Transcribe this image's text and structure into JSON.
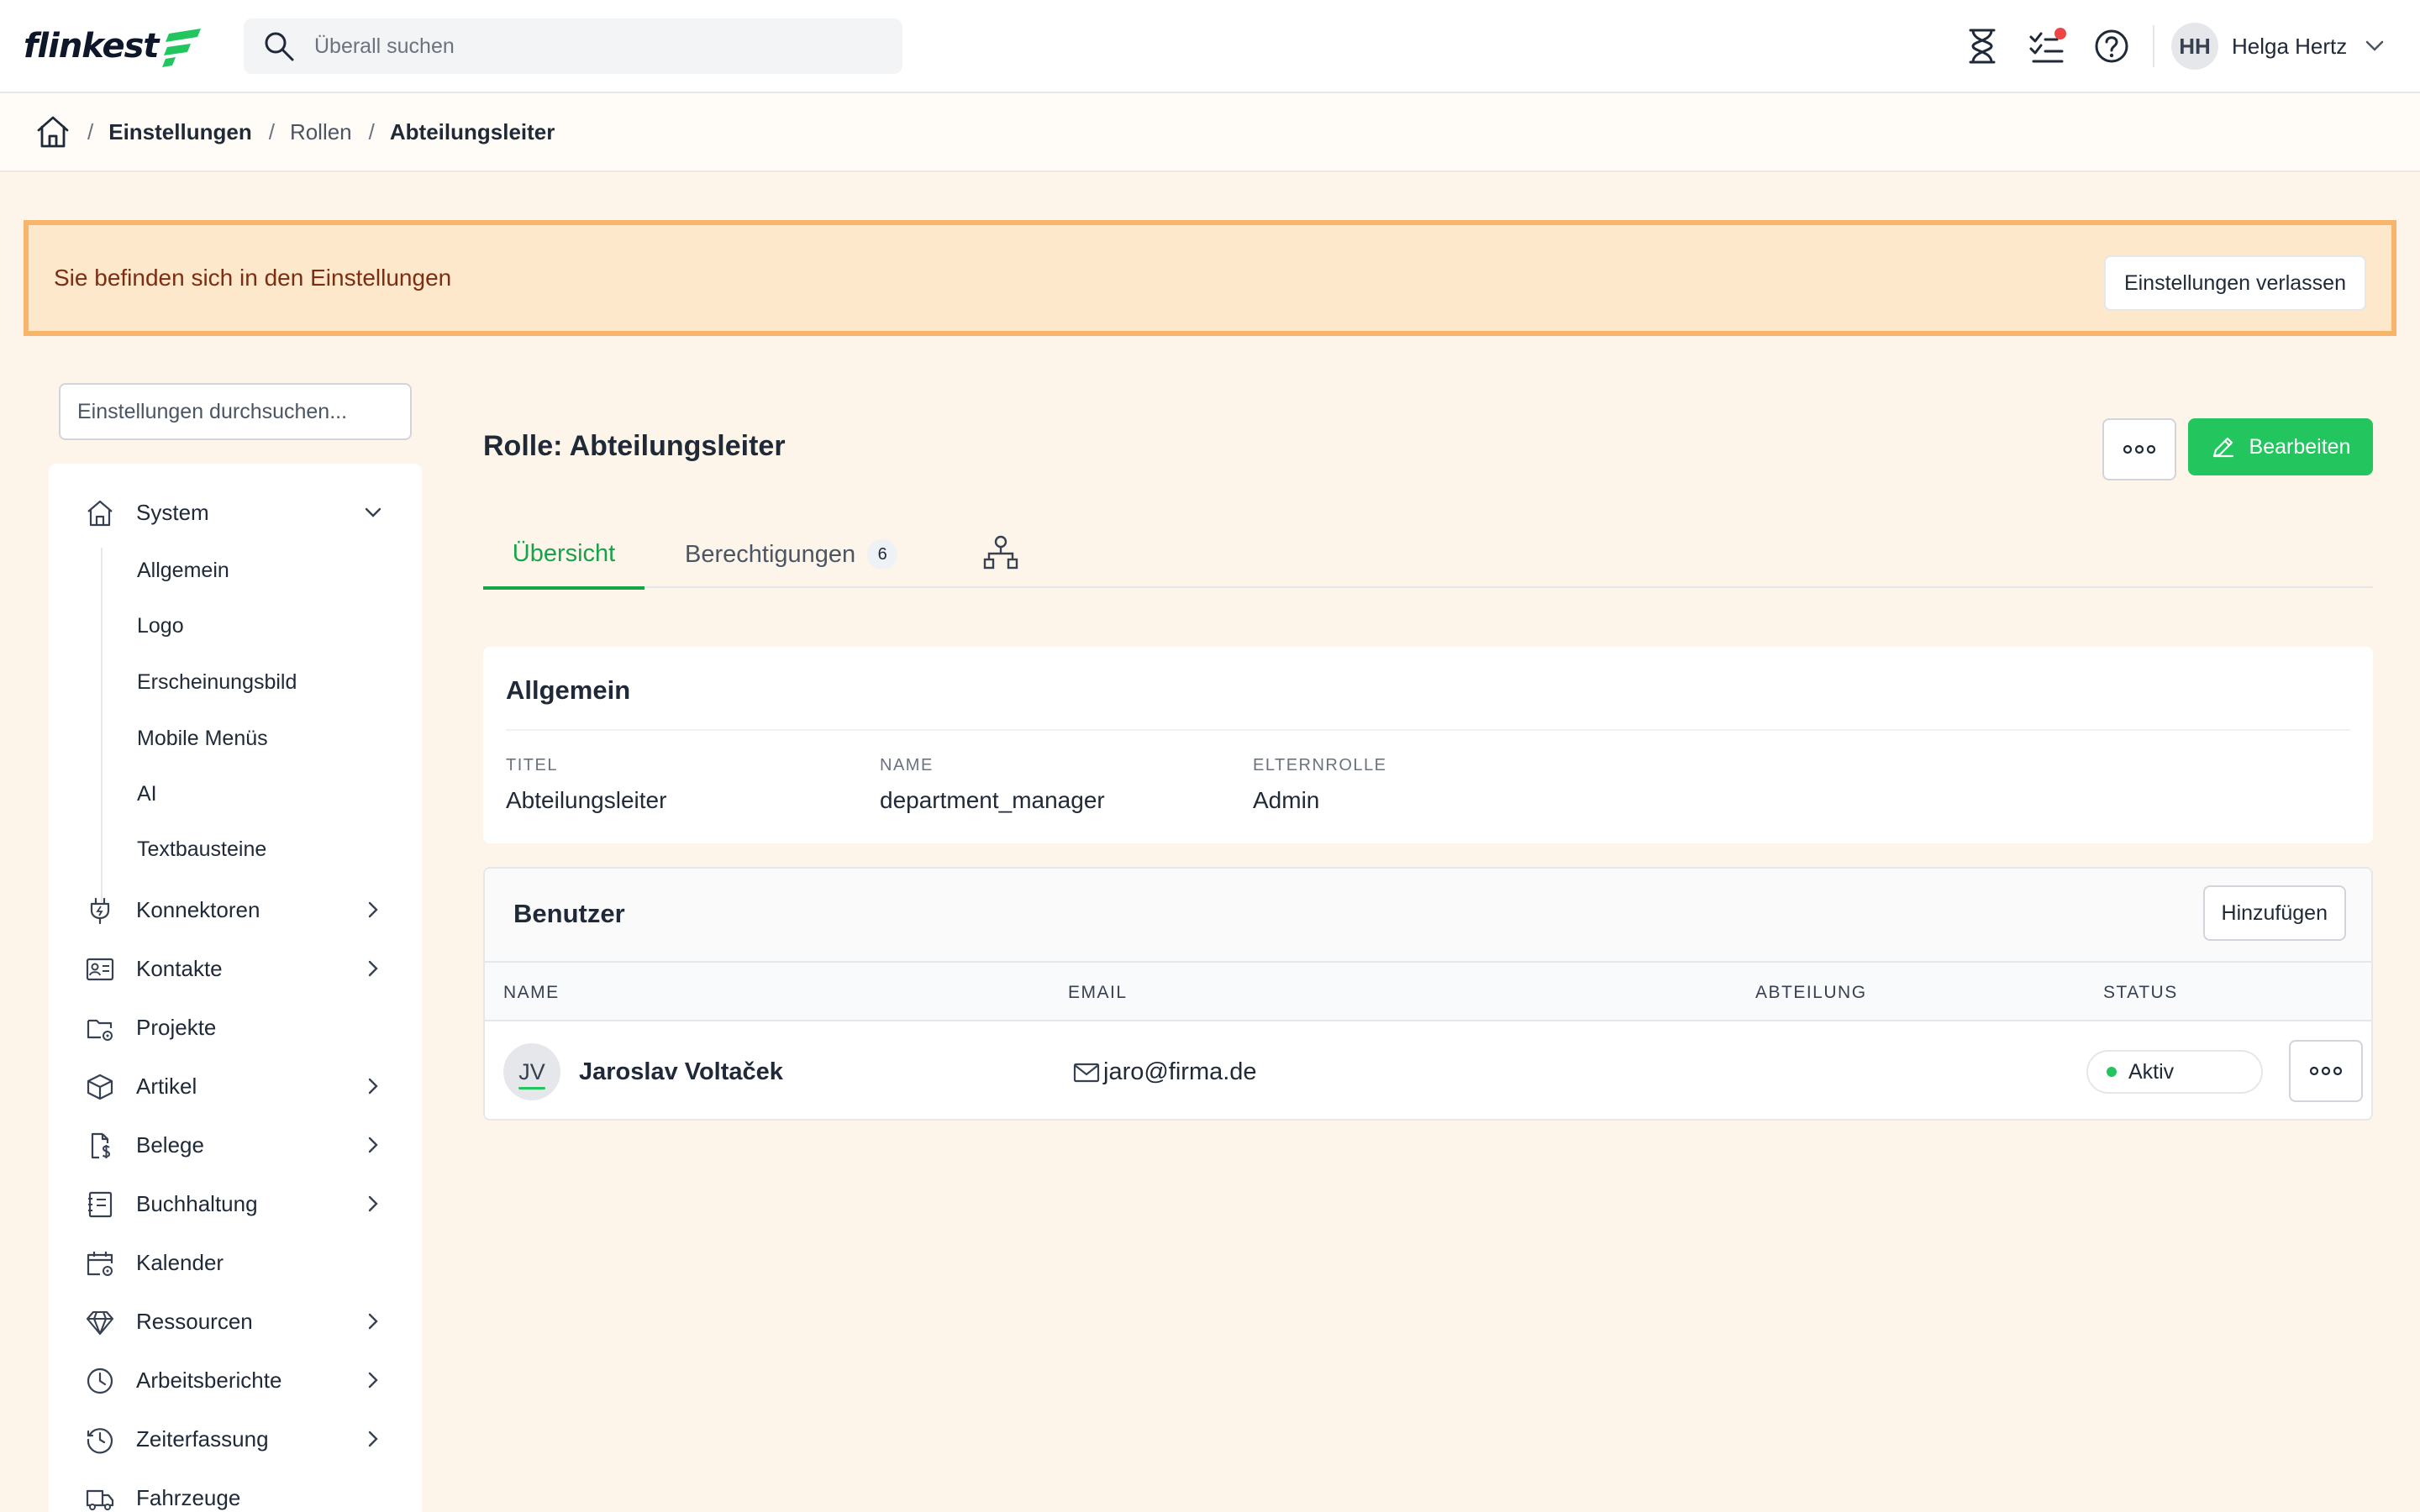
{
  "app": {
    "logo_text": "flinkest"
  },
  "topbar": {
    "search_placeholder": "Überall suchen",
    "user": {
      "initials": "HH",
      "name": "Helga Hertz"
    },
    "icons": [
      "hourglass-icon",
      "tasks-icon",
      "help-icon",
      "chevron-down-icon"
    ],
    "notification_color": "#ef4444"
  },
  "breadcrumb": {
    "items": [
      "Einstellungen",
      "Rollen",
      "Abteilungsleiter"
    ]
  },
  "banner": {
    "text": "Sie befinden sich in den Einstellungen",
    "button": "Einstellungen verlassen"
  },
  "sidebar": {
    "search_placeholder": "Einstellungen durchsuchen...",
    "system": {
      "label": "System",
      "children": [
        "Allgemein",
        "Logo",
        "Erscheinungsbild",
        "Mobile Menüs",
        "AI",
        "Textbausteine"
      ]
    },
    "items": [
      {
        "label": "Konnektoren",
        "icon": "plug-icon",
        "expandable": true
      },
      {
        "label": "Kontakte",
        "icon": "contact-card-icon",
        "expandable": true
      },
      {
        "label": "Projekte",
        "icon": "folder-gear-icon",
        "expandable": false
      },
      {
        "label": "Artikel",
        "icon": "box-icon",
        "expandable": true
      },
      {
        "label": "Belege",
        "icon": "document-dollar-icon",
        "expandable": true
      },
      {
        "label": "Buchhaltung",
        "icon": "ledger-icon",
        "expandable": true
      },
      {
        "label": "Kalender",
        "icon": "calendar-gear-icon",
        "expandable": false
      },
      {
        "label": "Ressourcen",
        "icon": "diamond-icon",
        "expandable": true
      },
      {
        "label": "Arbeitsberichte",
        "icon": "clock-icon",
        "expandable": true
      },
      {
        "label": "Zeiterfassung",
        "icon": "history-icon",
        "expandable": true
      },
      {
        "label": "Fahrzeuge",
        "icon": "truck-icon",
        "expandable": false
      }
    ]
  },
  "main": {
    "title": "Rolle: Abteilungsleiter",
    "edit_label": "Bearbeiten",
    "tabs": {
      "overview": "Übersicht",
      "permissions": "Berechtigungen",
      "permissions_count": "6"
    },
    "general": {
      "title": "Allgemein",
      "fields": [
        {
          "label": "TITEL",
          "value": "Abteilungsleiter"
        },
        {
          "label": "NAME",
          "value": "department_manager"
        },
        {
          "label": "ELTERNROLLE",
          "value": "Admin"
        }
      ]
    },
    "users": {
      "title": "Benutzer",
      "add_label": "Hinzufügen",
      "columns": [
        "NAME",
        "EMAIL",
        "ABTEILUNG",
        "STATUS"
      ],
      "rows": [
        {
          "initials": "JV",
          "name": "Jaroslav Voltaček",
          "email": "jaro@firma.de",
          "department": "",
          "status": "Aktiv"
        }
      ]
    }
  },
  "colors": {
    "accent": "#22c55e",
    "banner_bg": "#fde8cc",
    "banner_border": "#f6b56a",
    "page_bg": "#fdf5e9"
  }
}
